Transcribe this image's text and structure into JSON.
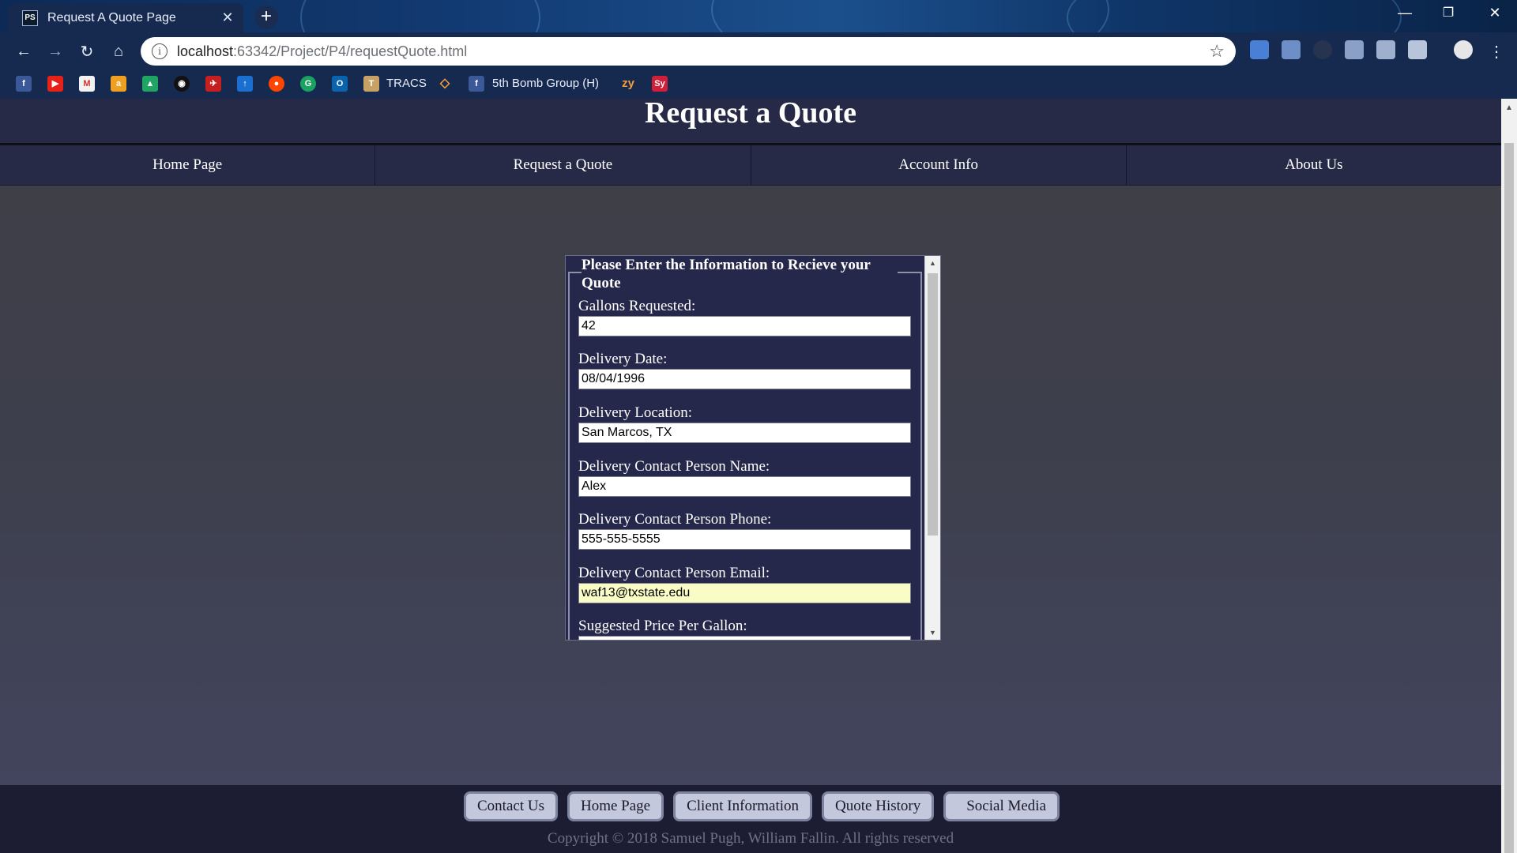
{
  "browser": {
    "tab_title": "Request A Quote Page",
    "tab_icon": "PS",
    "url_host": "localhost",
    "url_path": ":63342/Project/P4/requestQuote.html",
    "bookmarks": {
      "tracs": "TRACS",
      "fifth_bomb_group": "5th Bomb Group (H)",
      "zy": "zy",
      "sy": "Sy"
    }
  },
  "page": {
    "title": "Request a Quote",
    "nav": [
      "Home Page",
      "Request a Quote",
      "Account Info",
      "About Us"
    ],
    "form": {
      "legend": "Please Enter the Information to Recieve your Quote",
      "fields": [
        {
          "label": "Gallons Requested:",
          "value": "42"
        },
        {
          "label": "Delivery Date:",
          "value": "08/04/1996"
        },
        {
          "label": "Delivery Location:",
          "value": "San Marcos, TX"
        },
        {
          "label": "Delivery Contact Person Name:",
          "value": "Alex"
        },
        {
          "label": "Delivery Contact Person Phone:",
          "value": "555-555-5555"
        },
        {
          "label": "Delivery Contact Person Email:",
          "value": "waf13@txstate.edu"
        },
        {
          "label": "Suggested Price Per Gallon:",
          "value": ""
        }
      ]
    },
    "footer": {
      "links": [
        "Contact Us",
        "Home Page",
        "Client Information",
        "Quote History",
        "Social Media"
      ],
      "copyright": "Copyright © 2018 Samuel Pugh, William Fallin. All rights reserved"
    }
  },
  "colors": {
    "header_bg": "#262a46",
    "form_bg": "#25284a",
    "footer_bg": "#1c1d33",
    "autofill_bg": "#fafcc6"
  }
}
